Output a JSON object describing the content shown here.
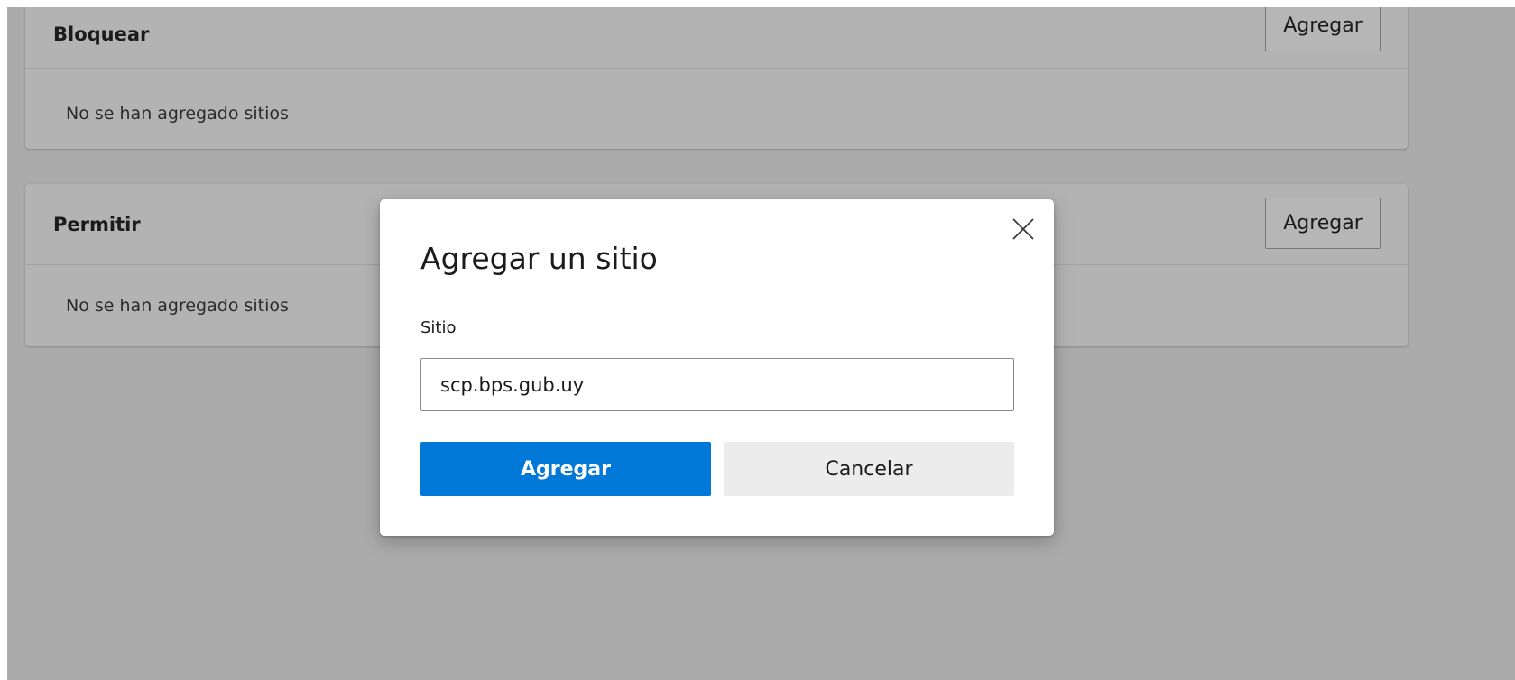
{
  "colors": {
    "accent": "#0078d7",
    "overlay": "#ababab",
    "dialog_background": "#ffffff",
    "secondary_button": "#ececec"
  },
  "block_section": {
    "title": "Bloquear",
    "add_label": "Agregar",
    "empty_text": "No se han agregado sitios"
  },
  "allow_section": {
    "title": "Permitir",
    "add_label": "Agregar",
    "empty_text": "No se han agregado sitios"
  },
  "dialog": {
    "title": "Agregar un sitio",
    "close_icon": "close-icon",
    "field_label": "Sitio",
    "field_value": "scp.bps.gub.uy",
    "confirm_label": "Agregar",
    "cancel_label": "Cancelar"
  }
}
